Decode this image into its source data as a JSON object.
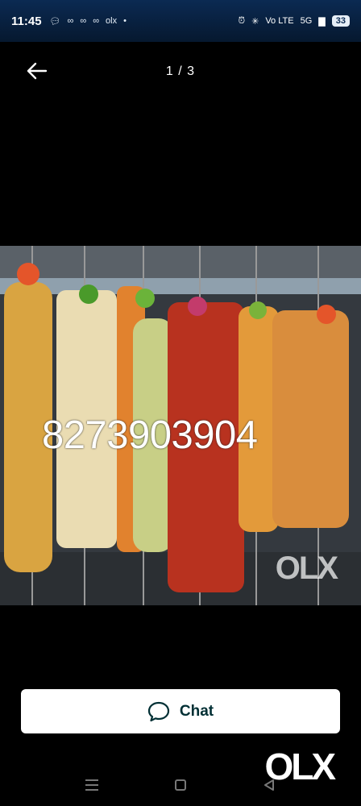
{
  "status_bar": {
    "time": "11:45",
    "left_icons": [
      "chat-bubble-icon",
      "link-icon",
      "link-icon",
      "link-icon",
      "olx-icon",
      "dot-icon"
    ],
    "network": "Vo LTE",
    "signal": "5G",
    "battery": "33"
  },
  "top_bar": {
    "counter": "1 / 3"
  },
  "photo": {
    "phone_overlay": "8273903904",
    "watermark": "OLX"
  },
  "chat_button": {
    "label": "Chat"
  },
  "brand": "OLX",
  "colors": {
    "background": "#000000",
    "status_bar": "#0b2a52",
    "button_text": "#002f34"
  }
}
